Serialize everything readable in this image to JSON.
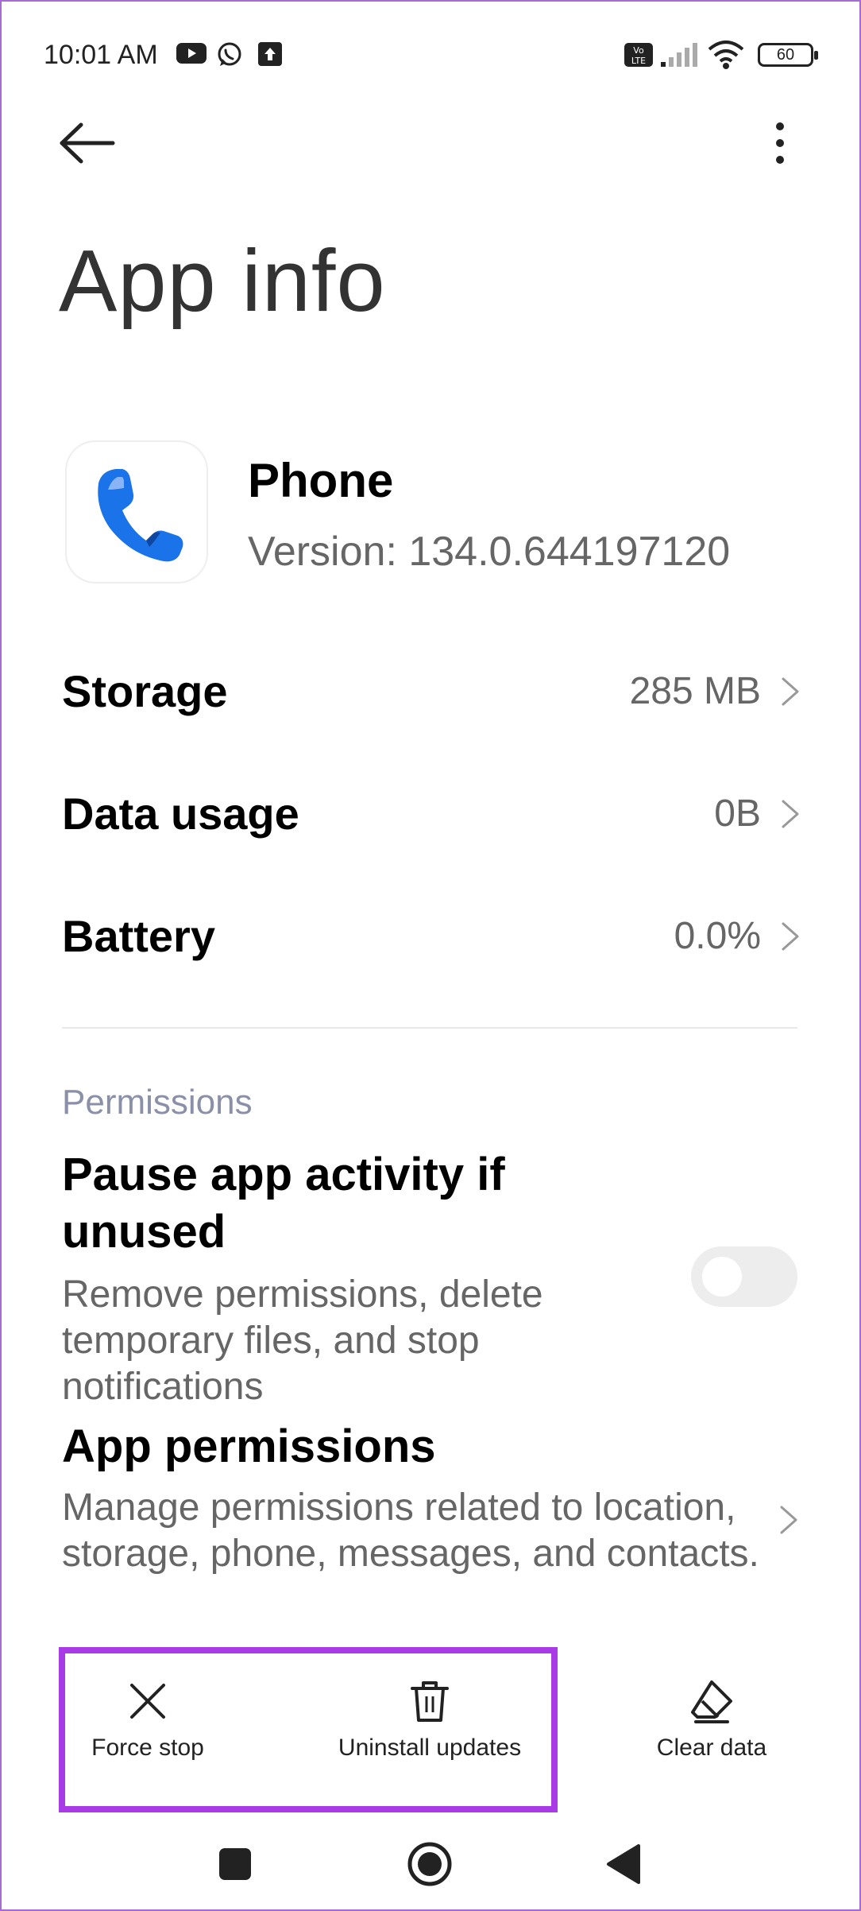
{
  "status_bar": {
    "time": "10:01 AM",
    "notification_icons": [
      "youtube-icon",
      "whatsapp-icon",
      "upload-icon"
    ],
    "volte_label": "Vo LTE",
    "battery_level": "60"
  },
  "page": {
    "title": "App info"
  },
  "app": {
    "name": "Phone",
    "version": "Version: 134.0.644197120",
    "icon": "phone-app-icon"
  },
  "rows": [
    {
      "label": "Storage",
      "value": "285 MB"
    },
    {
      "label": "Data usage",
      "value": "0B"
    },
    {
      "label": "Battery",
      "value": "0.0%"
    }
  ],
  "permissions": {
    "section_header": "Permissions",
    "pause_title": "Pause app activity if unused",
    "pause_desc": "Remove permissions, delete temporary files, and stop notifications",
    "pause_enabled": false,
    "app_permissions_title": "App permissions",
    "app_permissions_desc": "Manage permissions related to location, storage, phone, messages, and contacts."
  },
  "actions": [
    {
      "label": "Force stop",
      "icon": "close-icon"
    },
    {
      "label": "Uninstall updates",
      "icon": "trash-icon"
    },
    {
      "label": "Clear data",
      "icon": "eraser-icon"
    }
  ],
  "colors": {
    "highlight": "#a93be6",
    "frame": "#a76bd8",
    "phone_blue": "#1a73e8"
  }
}
